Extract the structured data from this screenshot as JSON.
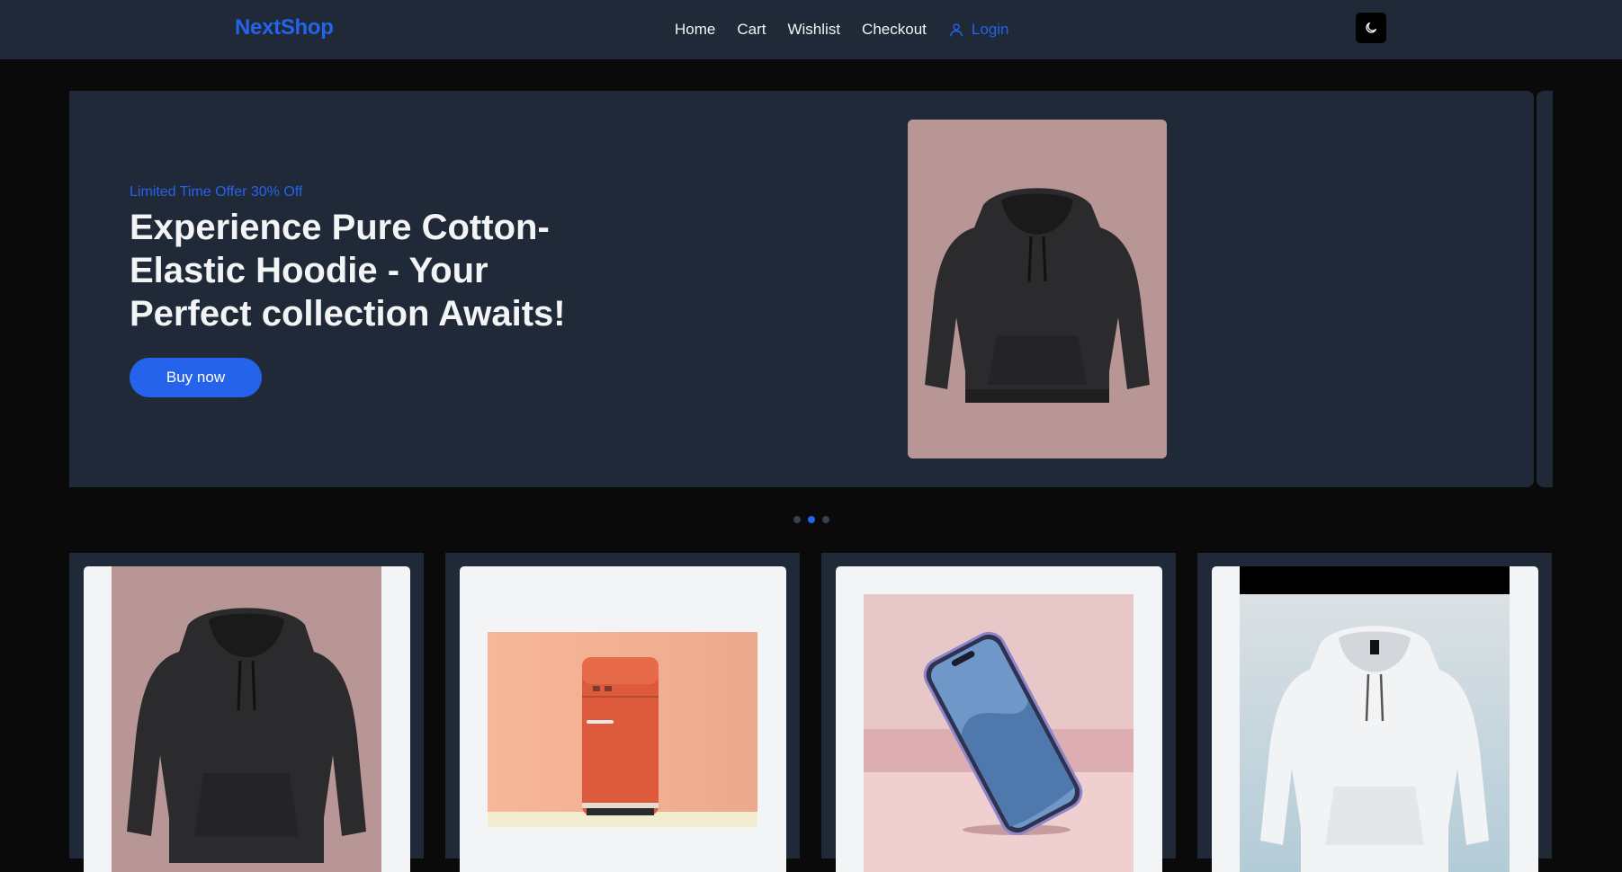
{
  "header": {
    "logo": "NextShop",
    "nav": [
      {
        "label": "Home"
      },
      {
        "label": "Cart"
      },
      {
        "label": "Wishlist"
      },
      {
        "label": "Checkout"
      }
    ],
    "login_label": "Login",
    "theme_icon": "moon-icon"
  },
  "hero": {
    "offer": "Limited Time Offer 30% Off",
    "title": "Experience Pure Cotton-Elastic Hoodie - Your Perfect collection Awaits!",
    "button_label": "Buy now",
    "image": "black-hoodie-image",
    "slides_count": 3,
    "active_slide": 2
  },
  "products": [
    {
      "image": "black-hoodie-image"
    },
    {
      "image": "orange-fridge-image"
    },
    {
      "image": "smartphone-image"
    },
    {
      "image": "white-hoodie-image"
    }
  ],
  "colors": {
    "accent": "#2563eb",
    "header_bg": "#1f2937",
    "page_bg": "#0a0a0b",
    "card_bg": "#f3f4f6"
  }
}
